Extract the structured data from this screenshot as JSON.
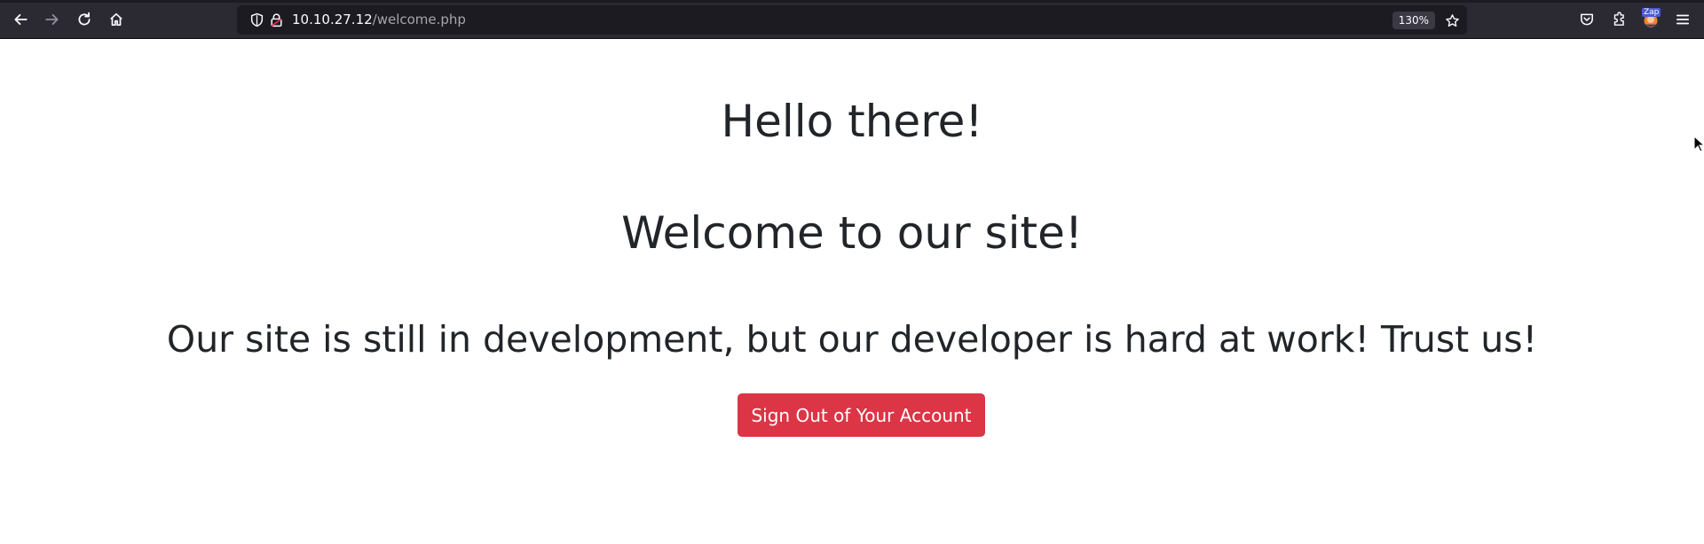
{
  "browser": {
    "url_host": "10.10.27.12",
    "url_path": "/welcome.php",
    "zoom": "130%",
    "extension_badge": "Zap",
    "icons": [
      "back-icon",
      "forward-icon",
      "reload-icon",
      "home-icon",
      "shield-icon",
      "lock-icon",
      "star-icon",
      "pocket-icon",
      "extensions-icon",
      "account-icon",
      "menu-icon"
    ]
  },
  "page": {
    "heading_hello": "Hello there!",
    "heading_welcome": "Welcome to our site!",
    "heading_dev": "Our site is still in development, but our developer is hard at work! Trust us!",
    "signout_label": "Sign Out of Your Account"
  },
  "colors": {
    "toolbar_bg": "#2b2a33",
    "urlbar_bg": "#1c1b22",
    "text": "#212529",
    "button_danger": "#dc3545"
  }
}
